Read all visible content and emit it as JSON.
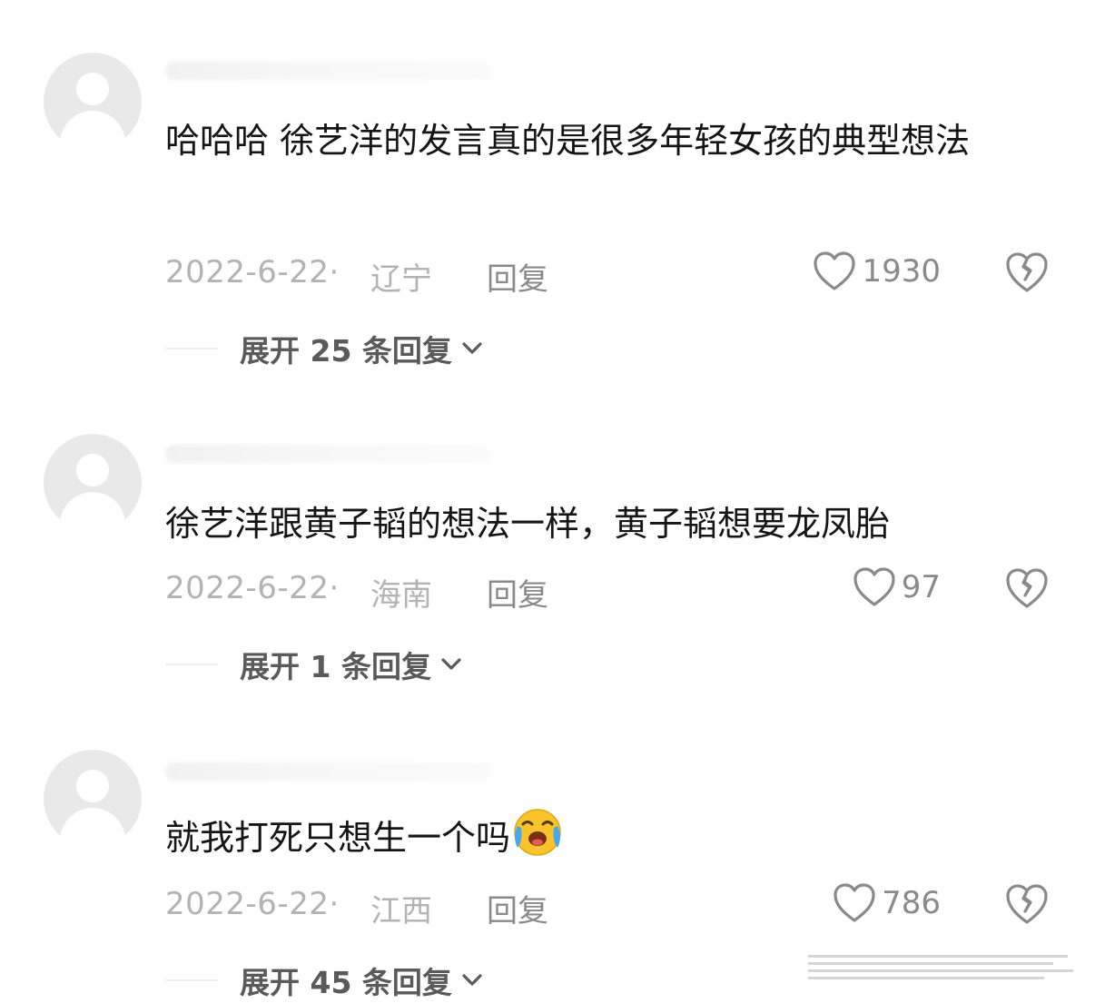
{
  "comments": [
    {
      "text": "哈哈哈 徐艺洋的发言真的是很多年轻女孩的典型想法",
      "date": "2022-6-22·",
      "location": "辽宁",
      "reply_label": "回复",
      "likes": "1930",
      "expand_label": "展开 25 条回复"
    },
    {
      "text": "徐艺洋跟黄子韬的想法一样，黄子韬想要龙凤胎",
      "date": "2022-6-22·",
      "location": "海南",
      "reply_label": "回复",
      "likes": "97",
      "expand_label": "展开 1 条回复"
    },
    {
      "text": "就我打死只想生一个吗",
      "emoji": "crying-laughing-emoji",
      "date": "2022-6-22·",
      "location": "江西",
      "reply_label": "回复",
      "likes": "786",
      "expand_label": "展开 45 条回复"
    }
  ],
  "icons": {
    "like": "heart-outline-icon",
    "dislike": "broken-heart-icon",
    "expand": "chevron-down-icon",
    "avatar": "default-avatar-icon"
  },
  "colors": {
    "meta_text": "#b3b3b3",
    "action_text": "#8a8a8a",
    "body_text": "#151515"
  }
}
